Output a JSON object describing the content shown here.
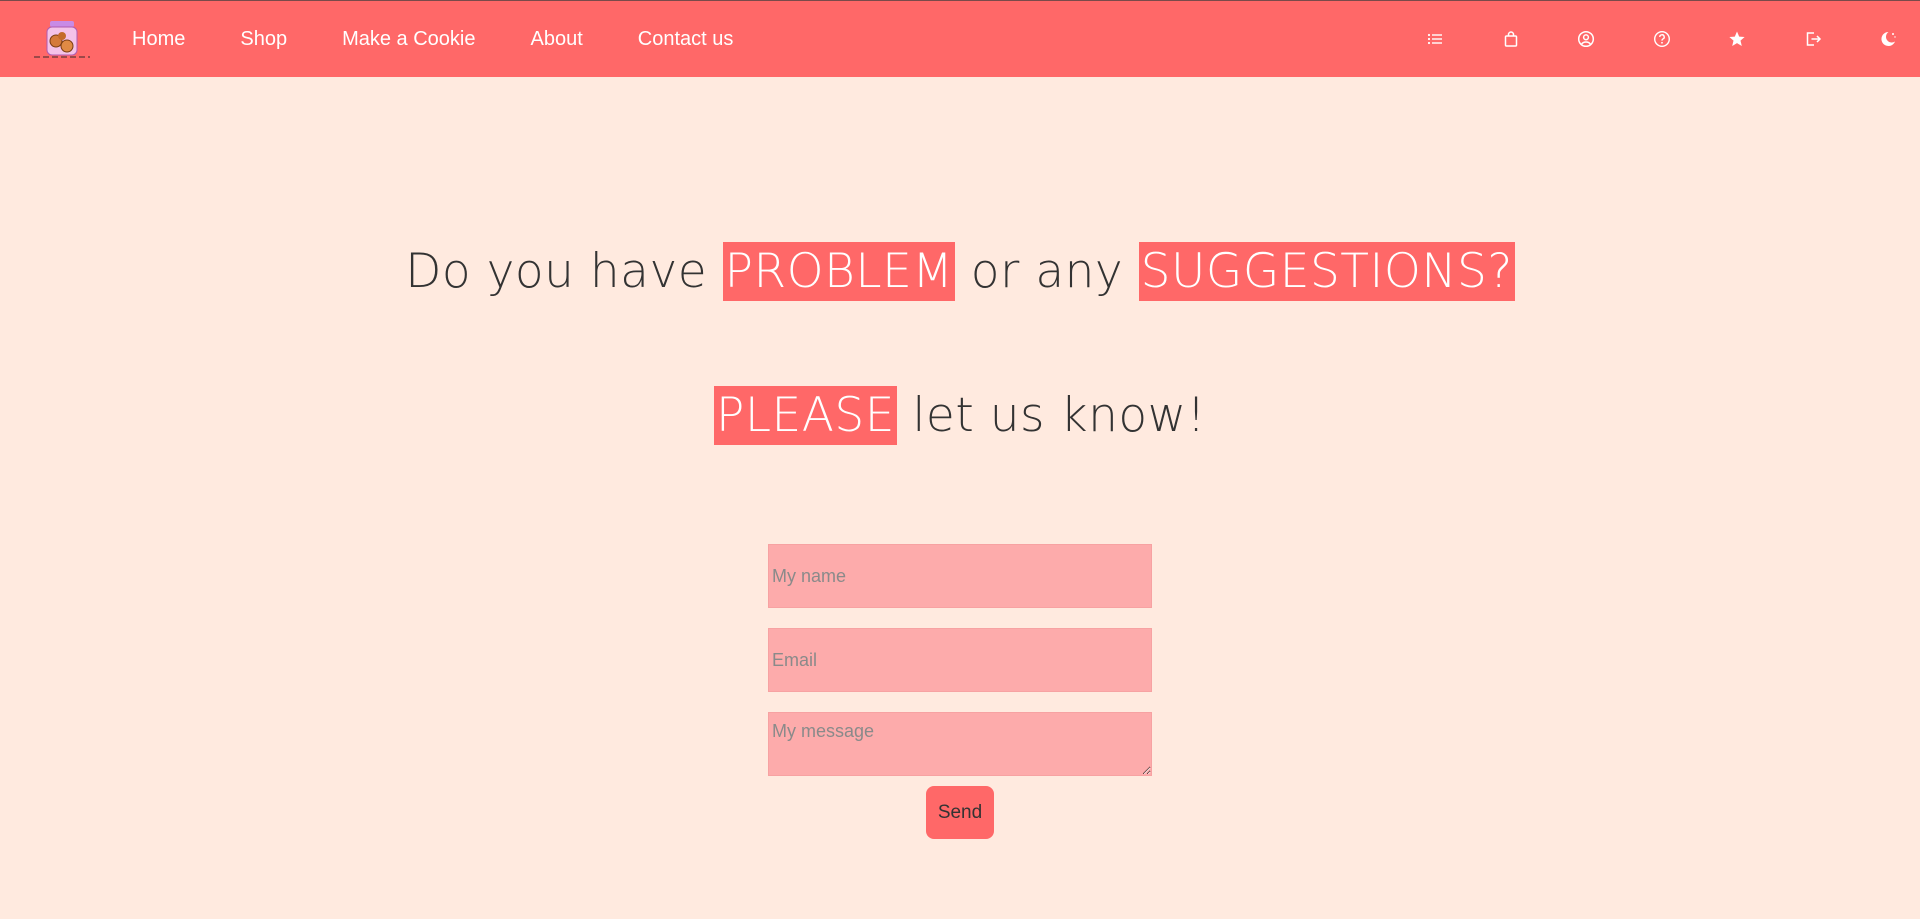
{
  "header": {
    "logo_icon": "cookie-jar-icon",
    "nav": [
      {
        "label": "Home"
      },
      {
        "label": "Shop"
      },
      {
        "label": "Make a Cookie"
      },
      {
        "label": "About"
      },
      {
        "label": "Contact us"
      }
    ],
    "icons": [
      "list-icon",
      "shopping-bag-icon",
      "user-circle-icon",
      "help-circle-icon",
      "star-icon",
      "logout-icon",
      "theme-toggle-icon"
    ]
  },
  "hero": {
    "line1": {
      "part1": "Do you have ",
      "hl1": "PROBLEM",
      "part2": " or any ",
      "hl2": "SUGGESTIONS?"
    },
    "line2": {
      "hl": "PLEASE",
      "part": " let us know!"
    }
  },
  "form": {
    "name_placeholder": "My name",
    "email_placeholder": "Email",
    "message_placeholder": "My message",
    "send_label": "Send"
  },
  "colors": {
    "accent": "#ff6868",
    "background": "#ffeadf",
    "field": "#fdabab"
  }
}
